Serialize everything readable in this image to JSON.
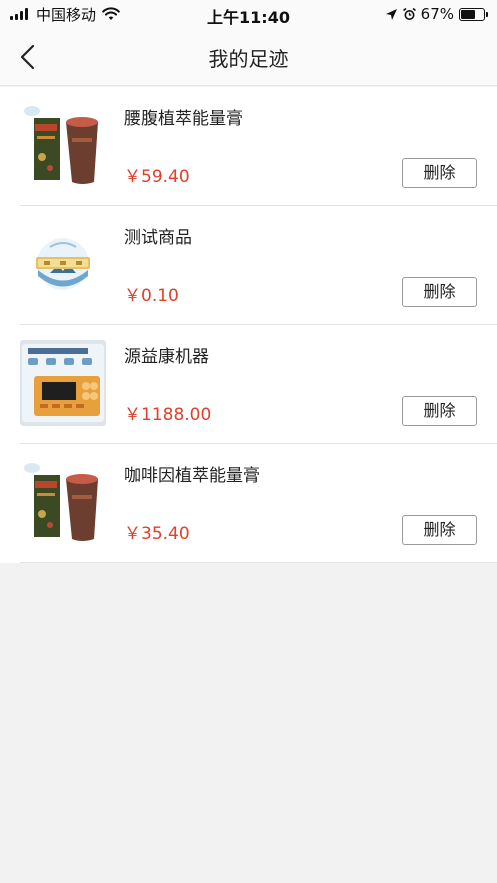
{
  "status_bar": {
    "carrier": "中国移动",
    "time": "上午11:40",
    "battery_percent": "67%",
    "battery_level": 0.67
  },
  "nav": {
    "title": "我的足迹"
  },
  "items": [
    {
      "name": "腰腹植萃能量膏",
      "price": "￥59.40",
      "delete_label": "删除",
      "image": "cream-product-image"
    },
    {
      "name": "测试商品",
      "price": "￥0.10",
      "delete_label": "删除",
      "image": "logo-product-image"
    },
    {
      "name": "源益康机器",
      "price": "￥1188.00",
      "delete_label": "删除",
      "image": "machine-product-image"
    },
    {
      "name": "咖啡因植萃能量膏",
      "price": "￥35.40",
      "delete_label": "删除",
      "image": "cream-product-image"
    }
  ]
}
